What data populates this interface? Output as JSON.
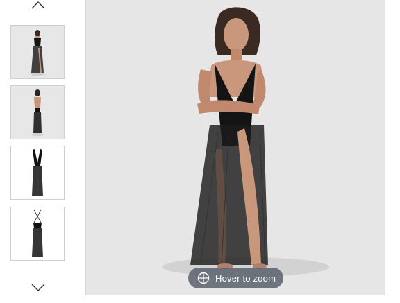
{
  "gallery": {
    "thumbnails": [
      {
        "kind": "model-front"
      },
      {
        "kind": "model-back"
      },
      {
        "kind": "product-front"
      },
      {
        "kind": "product-back"
      }
    ],
    "scroll_up_icon": "chevron-up-icon",
    "scroll_down_icon": "chevron-down-icon"
  },
  "main_image": {
    "zoom_hint": "Hover to zoom",
    "zoom_icon": "crosshair-circle-icon"
  },
  "colors": {
    "image_background": "#e6e6e6",
    "zoom_pill": "#5a626c",
    "garment": "#151515"
  }
}
